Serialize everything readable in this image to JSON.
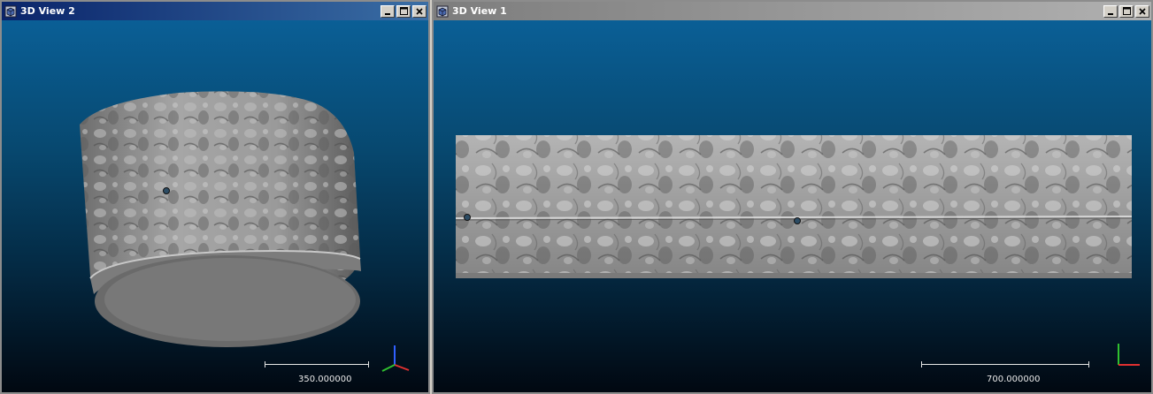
{
  "windows": [
    {
      "id": "view2",
      "title": "3D View 2",
      "active": true,
      "scale_label": "350.000000"
    },
    {
      "id": "view1",
      "title": "3D View 1",
      "active": false,
      "scale_label": "700.000000"
    }
  ],
  "icons": {
    "window": "cube-window-icon",
    "minimize": "minimize-icon",
    "maximize": "maximize-icon",
    "close": "close-icon",
    "axes": "axis-triad-icon"
  },
  "colors": {
    "active_title": "#0a246a",
    "inactive_title": "#808080",
    "viewport_top": "#0a5f96",
    "viewport_bottom": "#010811",
    "mesh": "#8c8c8c",
    "axis_x": "#e03030",
    "axis_y": "#30c030",
    "axis_z": "#3060ff"
  }
}
